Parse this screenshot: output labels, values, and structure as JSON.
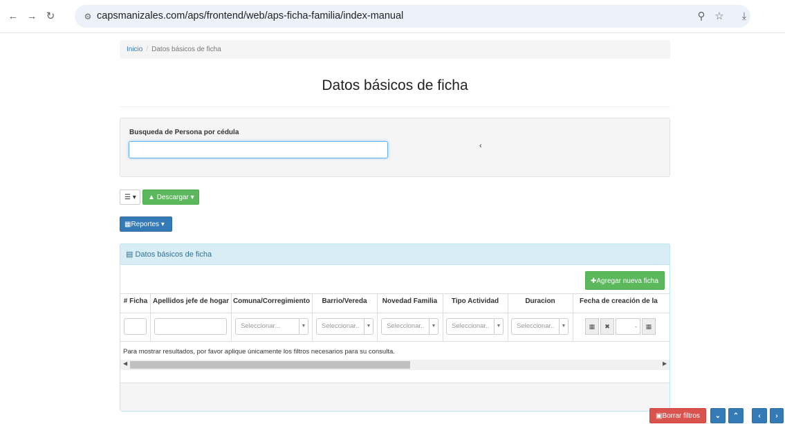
{
  "browser": {
    "url": "capsmanizales.com/aps/frontend/web/aps-ficha-familia/index-manual",
    "icons": [
      "back-icon",
      "forward-icon",
      "reload-icon",
      "site-settings-icon",
      "zoom-icon",
      "bookmark-star-icon",
      "download-icon"
    ]
  },
  "breadcrumb": {
    "home": "Inicio",
    "separator": "/",
    "current": "Datos básicos de ficha"
  },
  "page": {
    "title": "Datos básicos de ficha"
  },
  "search": {
    "label": "Busqueda de Persona por cédula",
    "value": ""
  },
  "toolbar": {
    "download_label": "Descargar",
    "reports_label": "Reportes"
  },
  "panel": {
    "heading": "Datos básicos de ficha",
    "add_label": "Agregar nueva ficha",
    "columns": [
      "# Ficha",
      "Apellidos jefe de hogar",
      "Comuna/Corregimiento",
      "Barrio/Vereda",
      "Novedad Familia",
      "Tipo Actividad",
      "Duracion",
      "Fecha de creación de la"
    ],
    "select_placeholder_full": "Seleccionar...",
    "select_placeholder_short": "Seleccionar..",
    "date_range_separator": "-",
    "hint": "Para mostrar resultados, por favor aplique únicamente los filtros necesarios para su consulta."
  },
  "floating": {
    "clear_filters_label": "Borrar filtros"
  },
  "colors": {
    "primary": "#337ab7",
    "success": "#5cb85c",
    "danger": "#d9534f",
    "panel_heading_bg": "#d9edf7"
  }
}
